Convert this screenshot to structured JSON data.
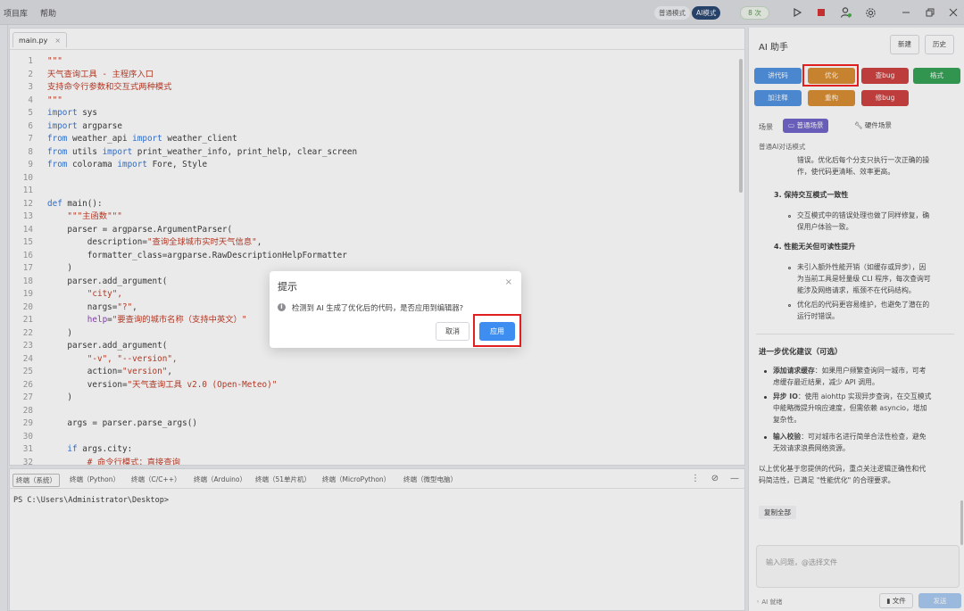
{
  "menu": {
    "items": [
      "项目库",
      "帮助"
    ]
  },
  "modes": {
    "normal": "普通模式",
    "ai": "AI模式",
    "credits": "8 次"
  },
  "colors": {
    "accent": "#3d8ef0",
    "highlight": "#e02020",
    "kw": "#2b6fd6",
    "str": "#c0341d",
    "func": "#8a3ab9"
  },
  "editor": {
    "tab_label": "main.py",
    "tab_close": "×",
    "lines": [
      {
        "n": "1",
        "t": "\"\"\"",
        "c": "str"
      },
      {
        "n": "2",
        "t": "天气查询工具 - 主程序入口",
        "c": "str"
      },
      {
        "n": "3",
        "t": "支持命令行参数和交互式两种模式",
        "c": "str"
      },
      {
        "n": "4",
        "t": "\"\"\"",
        "c": "str"
      },
      {
        "n": "5",
        "t": "import sys",
        "c": "kw"
      },
      {
        "n": "6",
        "t": "import argparse",
        "c": "kw"
      },
      {
        "n": "7",
        "t": "from weather_api import weather_client",
        "c": "kw"
      },
      {
        "n": "8",
        "t": "from utils import print_weather_info, print_help, clear_screen",
        "c": "kw"
      },
      {
        "n": "9",
        "t": "from colorama import Fore, Style",
        "c": "kw"
      },
      {
        "n": "10",
        "t": "",
        "c": ""
      },
      {
        "n": "11",
        "t": "",
        "c": ""
      },
      {
        "n": "12",
        "t": "def main():",
        "c": "kw"
      },
      {
        "n": "13",
        "t": "    \"\"\"主函数\"\"\"",
        "c": "str"
      },
      {
        "n": "14",
        "t": "    parser = argparse.ArgumentParser(",
        "c": ""
      },
      {
        "n": "15",
        "t": "        description=\"查询全球城市实时天气信息\",",
        "c": "mix"
      },
      {
        "n": "16",
        "t": "        formatter_class=argparse.RawDescriptionHelpFormatter",
        "c": ""
      },
      {
        "n": "17",
        "t": "    )",
        "c": ""
      },
      {
        "n": "18",
        "t": "    parser.add_argument(",
        "c": ""
      },
      {
        "n": "19",
        "t": "        \"city\",",
        "c": "str"
      },
      {
        "n": "20",
        "t": "        nargs=\"?\",",
        "c": "mix"
      },
      {
        "n": "21",
        "t": "        help=\"要查询的城市名称（支持中英文）\"",
        "c": "mixf"
      },
      {
        "n": "22",
        "t": "    )",
        "c": ""
      },
      {
        "n": "23",
        "t": "    parser.add_argument(",
        "c": ""
      },
      {
        "n": "24",
        "t": "        \"-v\", \"--version\",",
        "c": "str"
      },
      {
        "n": "25",
        "t": "        action=\"version\",",
        "c": "mix"
      },
      {
        "n": "26",
        "t": "        version=\"天气查询工具 v2.0 (Open-Meteo)\"",
        "c": "mix"
      },
      {
        "n": "27",
        "t": "    )",
        "c": ""
      },
      {
        "n": "28",
        "t": "",
        "c": ""
      },
      {
        "n": "29",
        "t": "    args = parser.parse_args()",
        "c": ""
      },
      {
        "n": "30",
        "t": "",
        "c": ""
      },
      {
        "n": "31",
        "t": "    if args.city:",
        "c": "kw"
      },
      {
        "n": "32",
        "t": "        # 命令行模式：直接查询",
        "c": "cmt"
      }
    ]
  },
  "terminal": {
    "tabs": [
      "终端（系统）",
      "终端（Python）",
      "终端（C/C++）",
      "终端（Arduino）",
      "终端（51单片机）",
      "终端（MicroPython）",
      "终端（微型电脑）"
    ],
    "prompt": "PS C:\\Users\\Administrator\\Desktop>"
  },
  "ai": {
    "title": "AI 助手",
    "new_btn": "新建",
    "history_btn": "历史",
    "actions": [
      {
        "label": "讲代码",
        "color": "#4a8fe0"
      },
      {
        "label": "优化",
        "color": "#d6892a"
      },
      {
        "label": "查bug",
        "color": "#cc3b3b"
      },
      {
        "label": "格式",
        "color": "#2d9e4f"
      },
      {
        "label": "加注释",
        "color": "#4a8fe0"
      },
      {
        "label": "重构",
        "color": "#d6892a"
      },
      {
        "label": "修bug",
        "color": "#cc3b3b"
      }
    ],
    "scene_label": "场景",
    "scene_normal": "普通场景",
    "scene_hw": "硬件场景",
    "subtitle": "普通AI对话模式",
    "content": {
      "p1a": "错误。优化后每个分支只执行一次正确的操",
      "p1b": "作，使代码更清晰、效率更高。",
      "h3": "3. 保持交互模式一致性",
      "p3a": "交互模式中的错误处理也做了同样修复，确",
      "p3b": "保用户体验一致。",
      "h4": "4. 性能无关但可读性提升",
      "p4a": "未引入额外性能开销（如缓存或异步），因",
      "p4b": "为当前工具是轻量级 CLI 程序，每次查询可",
      "p4c": "能涉及网络请求，瓶颈不在代码结构。",
      "p5a": "优化后的代码更容易维护，也避免了潜在的",
      "p5b": "运行时错误。",
      "h_next": "进一步优化建议（可选）",
      "s1h": "添加请求缓存",
      "s1a": "：如果用户频繁查询同一城市，可考",
      "s1b": "虑缓存最近结果，减少 API 调用。",
      "s2h": "异步 IO",
      "s2a": "：使用 aiohttp 实现异步查询，在交互模式",
      "s2b": "中能略微提升响应速度，但需依赖 asyncio，增加",
      "s2c": "复杂性。",
      "s3h": "输入校验",
      "s3a": "：可对城市名进行简单合法性检查，避免",
      "s3b": "无效请求浪费网络资源。",
      "sum_a": "以上优化基于您提供的代码，重点关注逻辑正确性和代",
      "sum_b": "码简洁性，已满足 \"性能优化\" 的合理要求。"
    },
    "copy_all": "复制全部",
    "input_placeholder": "输入问题，@选择文件",
    "status": "◦ AI 就绪",
    "file_btn": "▮ 文件",
    "send_btn": "发送"
  },
  "dialog": {
    "title": "提示",
    "close": "×",
    "message": "检测到 AI 生成了优化后的代码，是否应用到编辑器?",
    "cancel": "取消",
    "apply": "应用"
  }
}
